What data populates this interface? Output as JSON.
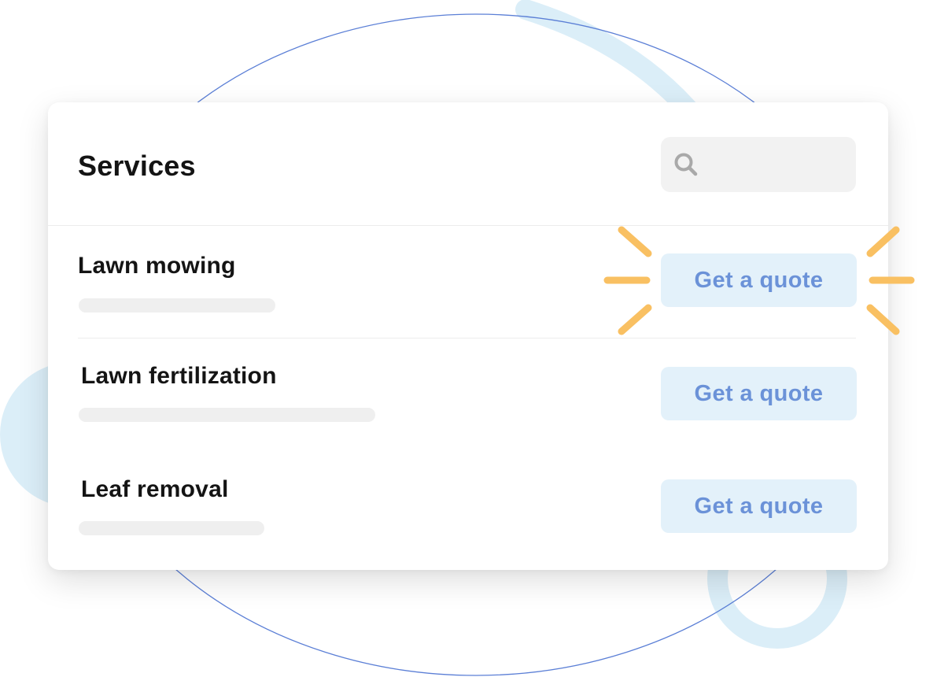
{
  "title": "Services",
  "search": {
    "value": "",
    "icon": "search-icon"
  },
  "services": [
    {
      "name": "Lawn mowing",
      "button_label": "Get a quote",
      "highlighted": true
    },
    {
      "name": "Lawn fertilization",
      "button_label": "Get a quote",
      "highlighted": false
    },
    {
      "name": "Leaf removal",
      "button_label": "Get a quote",
      "highlighted": false
    }
  ],
  "colors": {
    "accent_text": "#6b92d8",
    "button_background": "#e3f1fa",
    "highlight": "#f9c062",
    "decoration_light_blue": "#dbeef8",
    "decoration_line": "#5b7fd6"
  }
}
